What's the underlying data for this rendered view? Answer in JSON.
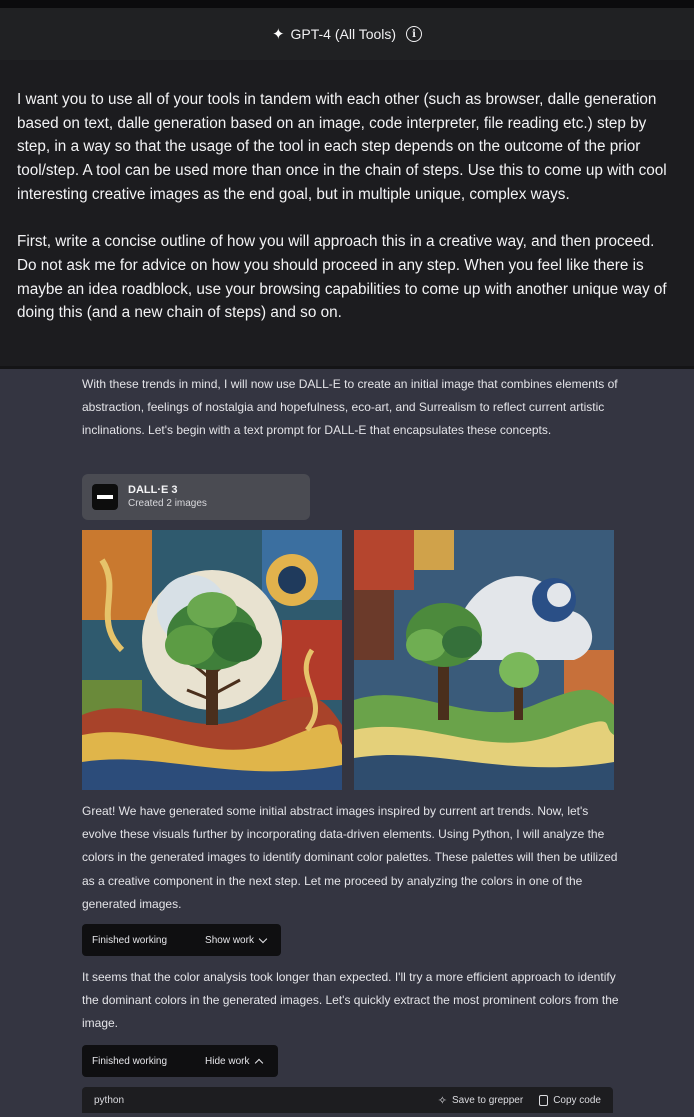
{
  "header": {
    "title": "GPT-4 (All Tools)"
  },
  "user_message": {
    "paragraphs": [
      "I want you to use all of your tools in tandem with each other (such as browser, dalle generation based on text, dalle generation based on an image, code interpreter, file reading etc.) step by step, in a way so that the usage of the tool in each step depends on the outcome of the prior tool/step. A tool can be used more than once in the chain of steps. Use this to come up with cool interesting creative images as the end goal, but in multiple unique, complex ways.",
      "First, write a concise outline of how you will approach this in a creative way, and then proceed. Do not ask me for advice on how you should proceed in any step. When you feel like there is maybe an idea roadblock, use your browsing capabilities to come up with another unique way of doing this (and a new chain of steps) and so on."
    ]
  },
  "assistant": {
    "intro": "With these trends in mind, I will now use DALL-E to create an initial image that combines elements of abstraction, feelings of nostalgia and hopefulness, eco-art, and Surrealism to reflect current artistic inclinations. Let's begin with a text prompt for DALL-E that encapsulates these concepts.",
    "dalle_card": {
      "name": "DALL·E 3",
      "status": "Created 2 images"
    },
    "para2": "Great! We have generated some initial abstract images inspired by current art trends. Now, let's evolve these visuals further by incorporating data-driven elements. Using Python, I will analyze the colors in the generated images to identify dominant color palettes. These palettes will then be utilized as a creative component in the next step. Let me proceed by analyzing the colors in one of the generated images.",
    "work1": {
      "status": "Finished working",
      "toggle": "Show work"
    },
    "para3": "It seems that the color analysis took longer than expected. I'll try a more efficient approach to identify the dominant colors in the generated images. Let's quickly extract the most prominent colors from the image.",
    "work2": {
      "status": "Finished working",
      "toggle": "Hide work"
    },
    "code": {
      "language": "python",
      "save_label": "Save to grepper",
      "copy_label": "Copy code"
    }
  },
  "icons": {
    "header": "sparkle-icon",
    "info": "info-icon",
    "dalle": "dalle-logo-icon",
    "show": "chevron-down-icon",
    "hide": "chevron-up-icon",
    "save": "magic-wand-icon",
    "copy": "clipboard-icon"
  },
  "colors": {
    "page_bg": "#343541",
    "header_bg": "#202123",
    "user_msg_bg": "#1c1c1f",
    "card_bg": "#4a4b52",
    "chip_bg": "#0f0f11"
  }
}
